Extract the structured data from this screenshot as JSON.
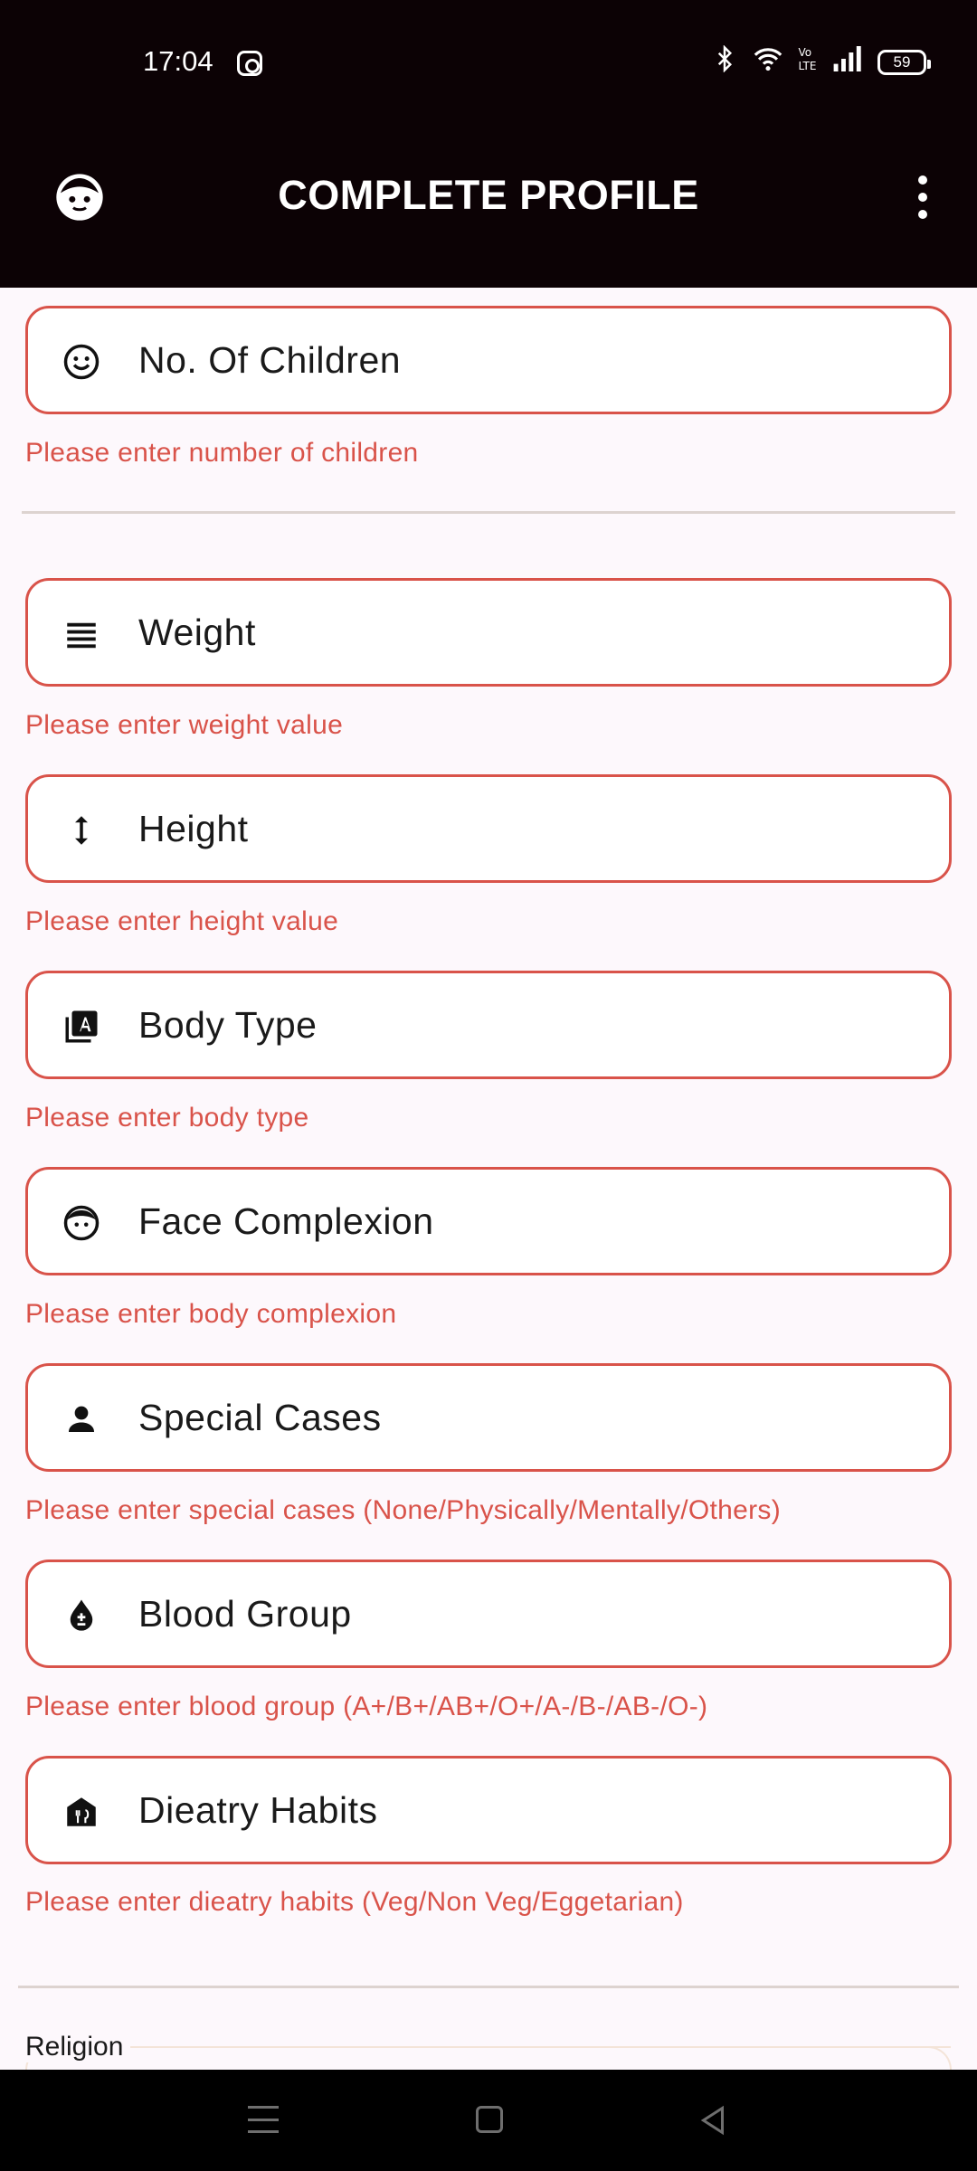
{
  "status_bar": {
    "time": "17:04",
    "battery": "59"
  },
  "app_bar": {
    "title": "COMPLETE PROFILE"
  },
  "fields": [
    {
      "label": "No. Of Children",
      "error": "Please enter number of children",
      "icon": "face-smile-icon"
    },
    {
      "label": "Weight",
      "error": "Please enter weight value",
      "icon": "lines-icon"
    },
    {
      "label": "Height",
      "error": "Please enter height value",
      "icon": "height-arrows-icon"
    },
    {
      "label": "Body Type",
      "error": "Please enter body type",
      "icon": "font-library-icon"
    },
    {
      "label": "Face Complexion",
      "error": "Please enter body complexion",
      "icon": "face-icon"
    },
    {
      "label": "Special Cases",
      "error": "Please enter special cases (None/Physically/Mentally/Others)",
      "icon": "person-icon"
    },
    {
      "label": "Blood Group",
      "error": "Please enter blood group (A+/B+/AB+/O+/A-/B-/AB-/O-)",
      "icon": "blood-drop-icon"
    },
    {
      "label": "Dieatry Habits",
      "error": "Please enter dieatry habits (Veg/Non Veg/Eggetarian)",
      "icon": "restaurant-icon"
    }
  ],
  "religion": {
    "label": "Religion"
  },
  "colors": {
    "error": "#d9534a",
    "app_bar": "#0c0205",
    "background": "#fdf8fc"
  }
}
